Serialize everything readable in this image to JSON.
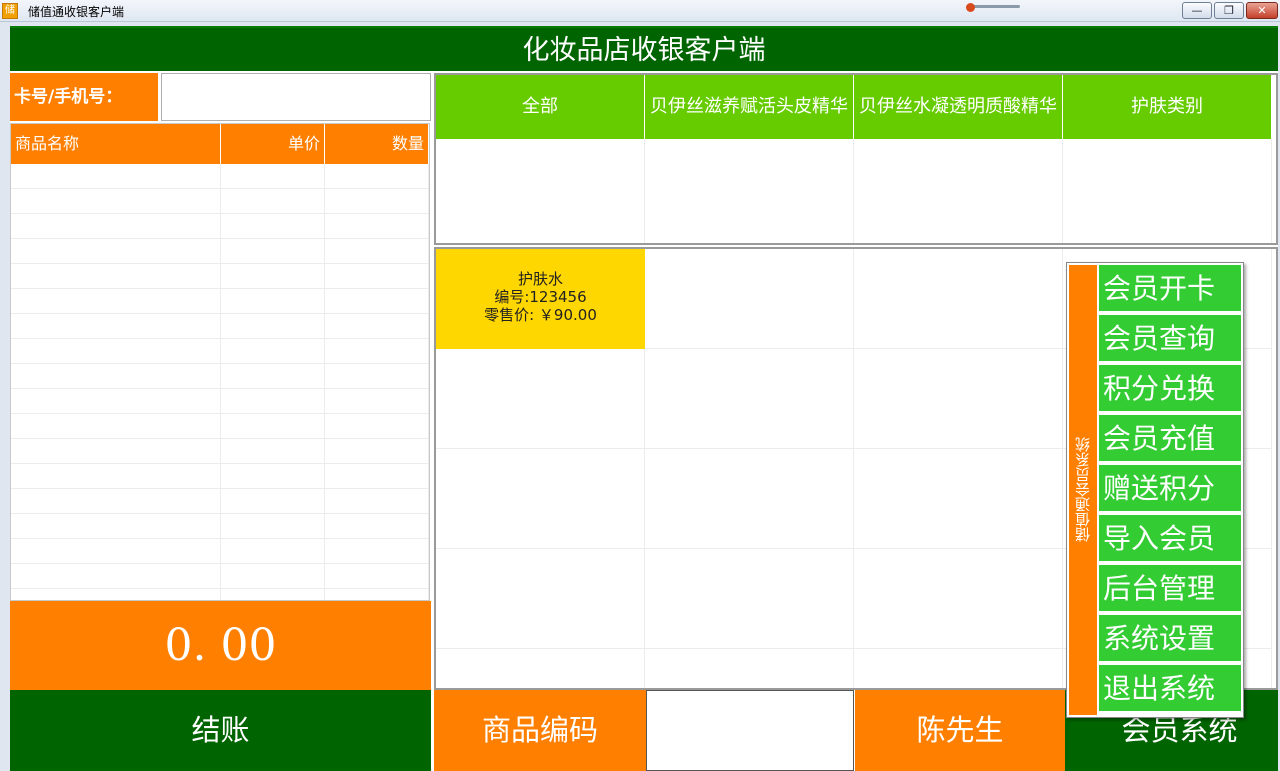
{
  "window": {
    "title": "储值通收银客户端",
    "icon_text": "储",
    "min_label": "—",
    "max_label": "❐",
    "close_label": "✕"
  },
  "header": {
    "title": "化妆品店收银客户端"
  },
  "card": {
    "label": "卡号/手机号：",
    "value": ""
  },
  "cart": {
    "columns": [
      "商品名称",
      "单价",
      "数量"
    ],
    "rows": []
  },
  "total": {
    "amount": "0. 00"
  },
  "checkout": {
    "label": "结账"
  },
  "categories": {
    "tabs": [
      "全部",
      "贝伊丝滋养赋活头皮精华",
      "贝伊丝水凝透明质酸精华",
      "护肤类别"
    ]
  },
  "products": [
    {
      "name": "护肤水",
      "code": "编号:123456",
      "price": "零售价: ￥90.00"
    }
  ],
  "bottom": {
    "code_label": "商品编码",
    "code_value": "",
    "member_name": "陈先生",
    "member_system": "会员系统"
  },
  "member_menu": {
    "title": "储值通会员系统",
    "items": [
      "会员开卡",
      "会员查询",
      "积分兑换",
      "会员充值",
      "赠送积分",
      "导入会员",
      "后台管理",
      "系统设置",
      "退出系统"
    ]
  },
  "colors": {
    "green_dark": "#006400",
    "orange": "#ff7f00",
    "green_light": "#66cc00",
    "menu_green": "#33cc33",
    "product_yellow": "#ffd700"
  }
}
